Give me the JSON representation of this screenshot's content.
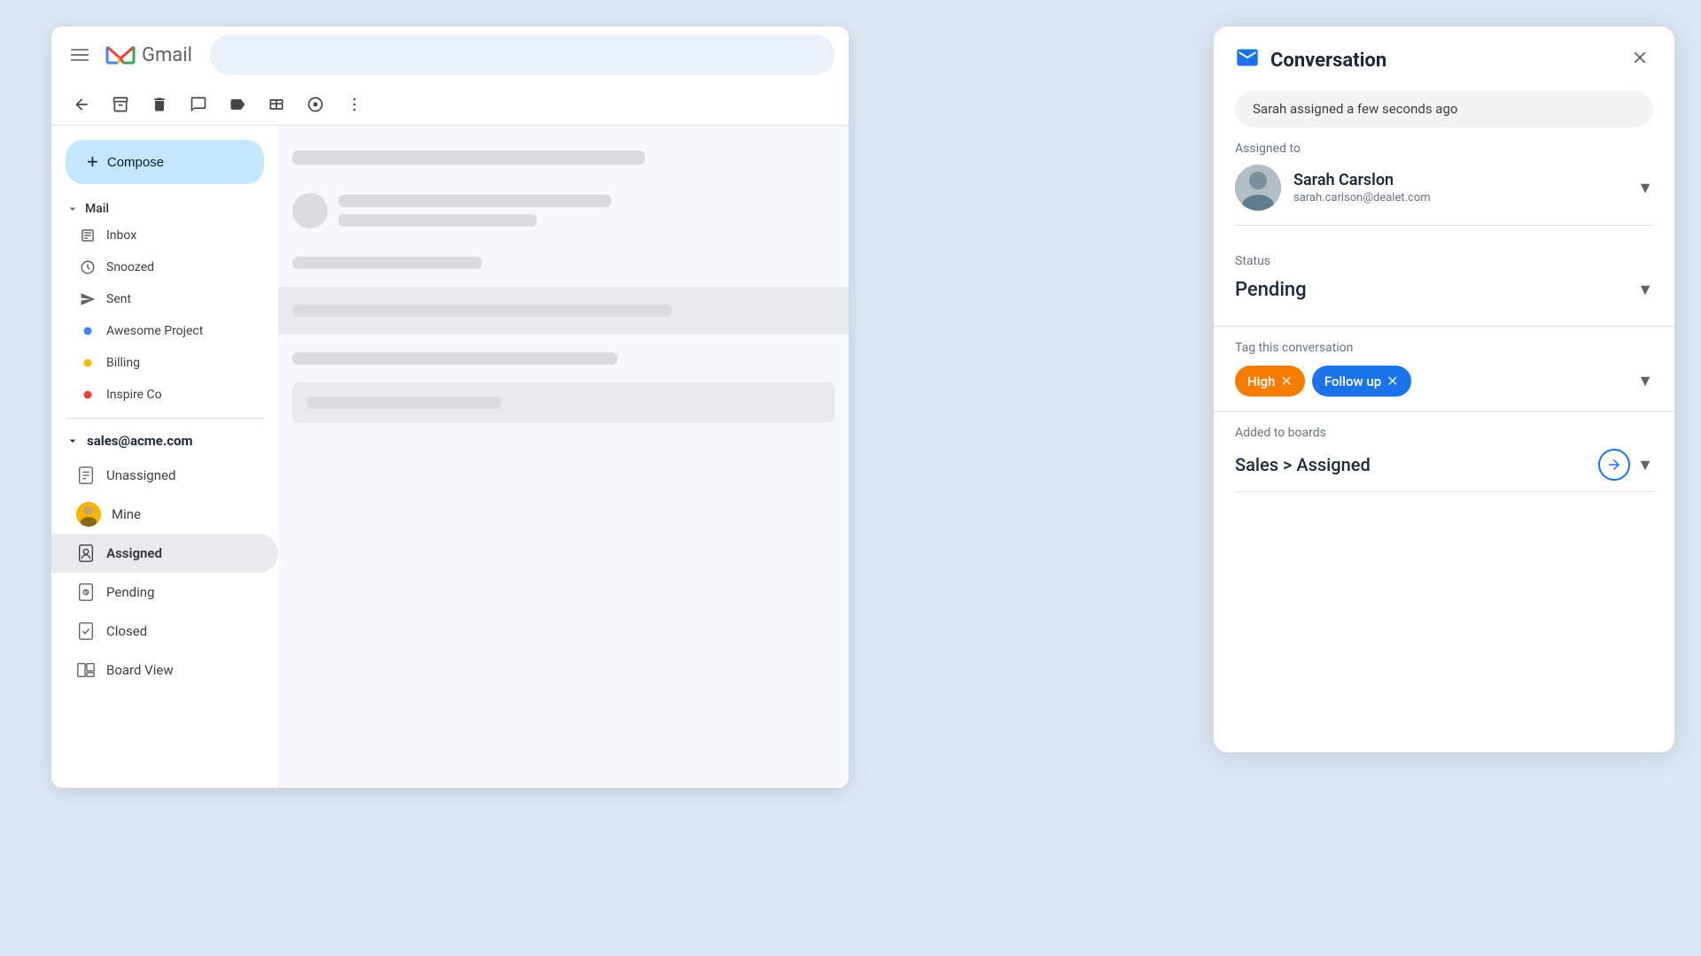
{
  "header": {
    "menu_label": "☰",
    "app_name": "Gmail",
    "search_placeholder": ""
  },
  "toolbar": {
    "back_label": "←",
    "archive_label": "⬆",
    "delete_label": "🗑",
    "snooze_label": "⬆",
    "label_label": "🏷",
    "split_label": "⚄",
    "circle_label": "◉",
    "more_label": "⋮"
  },
  "sidebar": {
    "compose_label": "Compose",
    "mail_section": {
      "label": "Mail",
      "items": [
        {
          "id": "inbox",
          "label": "Inbox",
          "icon": "☐"
        },
        {
          "id": "snoozed",
          "label": "Snoozed",
          "icon": "⏱"
        },
        {
          "id": "sent",
          "label": "Sent",
          "icon": "▷"
        }
      ],
      "labels": [
        {
          "id": "awesome-project",
          "label": "Awesome Project",
          "color": "#4285f4"
        },
        {
          "id": "billing",
          "label": "Billing",
          "color": "#fbbc04"
        },
        {
          "id": "inspire-co",
          "label": "Inspire Co",
          "color": "#ea4335"
        }
      ]
    },
    "sales_section": {
      "label": "sales@acme.com",
      "items": [
        {
          "id": "unassigned",
          "label": "Unassigned",
          "icon": "clipboard"
        },
        {
          "id": "mine",
          "label": "Mine",
          "icon": "avatar"
        },
        {
          "id": "assigned",
          "label": "Assigned",
          "icon": "person",
          "active": true
        },
        {
          "id": "pending",
          "label": "Pending",
          "icon": "clock-clipboard"
        },
        {
          "id": "closed",
          "label": "Closed",
          "icon": "check-clipboard"
        },
        {
          "id": "board-view",
          "label": "Board View",
          "icon": "board"
        }
      ]
    }
  },
  "conversation": {
    "title": "Conversation",
    "banner": "Sarah assigned a few seconds ago",
    "assigned_to_label": "Assigned to",
    "assigned_name": "Sarah Carslon",
    "assigned_email": "sarah.carlson@dealet.com",
    "status_label": "Status",
    "status_value": "Pending",
    "tags_label": "Tag this conversation",
    "tags": [
      {
        "id": "high",
        "label": "High",
        "type": "high"
      },
      {
        "id": "follow-up",
        "label": "Follow up",
        "type": "followup"
      }
    ],
    "boards_label": "Added to boards",
    "boards_value": "Sales > Assigned"
  }
}
